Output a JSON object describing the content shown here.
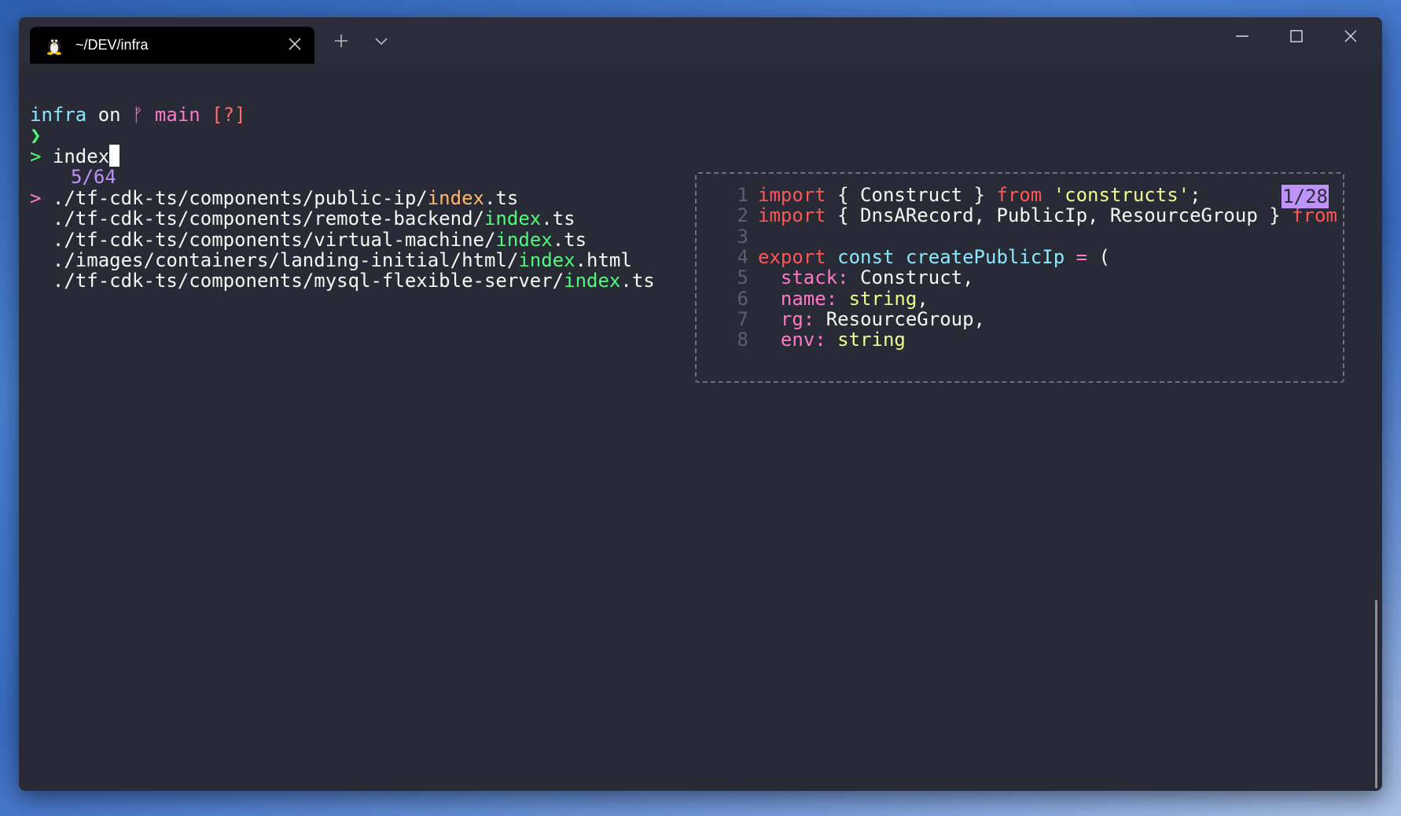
{
  "window": {
    "tab_title": "~/DEV/infra",
    "controls": {
      "minimize": "minimize-icon",
      "maximize": "maximize-icon",
      "close": "close-icon"
    }
  },
  "terminal": {
    "prompt": {
      "dir": "infra",
      "on": "on",
      "branch_icon": "git-branch-icon",
      "branch_glyph": "ᚠ",
      "branch": "main",
      "status": "[?]",
      "arrow": "❯"
    },
    "query_marker": ">",
    "query": "index",
    "match_count": "5/64",
    "results": [
      {
        "prefix": "./tf-cdk-ts/components/public-ip/",
        "match": "index",
        "suffix": ".ts",
        "selected": true
      },
      {
        "prefix": "./tf-cdk-ts/components/remote-backend/",
        "match": "index",
        "suffix": ".ts",
        "selected": false
      },
      {
        "prefix": "./tf-cdk-ts/components/virtual-machine/",
        "match": "index",
        "suffix": ".ts",
        "selected": false
      },
      {
        "prefix": "./images/containers/landing-initial/html/",
        "match": "index",
        "suffix": ".html",
        "selected": false
      },
      {
        "prefix": "./tf-cdk-ts/components/mysql-flexible-server/",
        "match": "index",
        "suffix": ".ts",
        "selected": false
      }
    ],
    "selected_marker": ">"
  },
  "preview": {
    "position": "1/28",
    "lines": [
      {
        "n": "1",
        "tokens": [
          [
            "import",
            "red"
          ],
          [
            " { Construct } ",
            "white"
          ],
          [
            "from",
            "red"
          ],
          [
            " ",
            "white"
          ],
          [
            "'constructs'",
            "yellow"
          ],
          [
            ";",
            "white"
          ]
        ]
      },
      {
        "n": "2",
        "tokens": [
          [
            "import",
            "red"
          ],
          [
            " { DnsARecord, PublicIp, ResourceGroup } ",
            "white"
          ],
          [
            "from",
            "red"
          ]
        ]
      },
      {
        "n": "3",
        "tokens": []
      },
      {
        "n": "4",
        "tokens": [
          [
            "export",
            "red"
          ],
          [
            " ",
            "white"
          ],
          [
            "const",
            "cyan"
          ],
          [
            " ",
            "white"
          ],
          [
            "createPublicIp",
            "cyan"
          ],
          [
            " ",
            "white"
          ],
          [
            "=",
            "pink"
          ],
          [
            " (",
            "white"
          ]
        ]
      },
      {
        "n": "5",
        "tokens": [
          [
            "  ",
            "white"
          ],
          [
            "stack:",
            "pink"
          ],
          [
            " Construct,",
            "white"
          ]
        ]
      },
      {
        "n": "6",
        "tokens": [
          [
            "  ",
            "white"
          ],
          [
            "name:",
            "pink"
          ],
          [
            " ",
            "white"
          ],
          [
            "string",
            "yellow"
          ],
          [
            ",",
            "white"
          ]
        ]
      },
      {
        "n": "7",
        "tokens": [
          [
            "  ",
            "white"
          ],
          [
            "rg:",
            "pink"
          ],
          [
            " ResourceGroup,",
            "white"
          ]
        ]
      },
      {
        "n": "8",
        "tokens": [
          [
            "  ",
            "white"
          ],
          [
            "env:",
            "pink"
          ],
          [
            " ",
            "white"
          ],
          [
            "string",
            "yellow"
          ]
        ]
      }
    ]
  }
}
